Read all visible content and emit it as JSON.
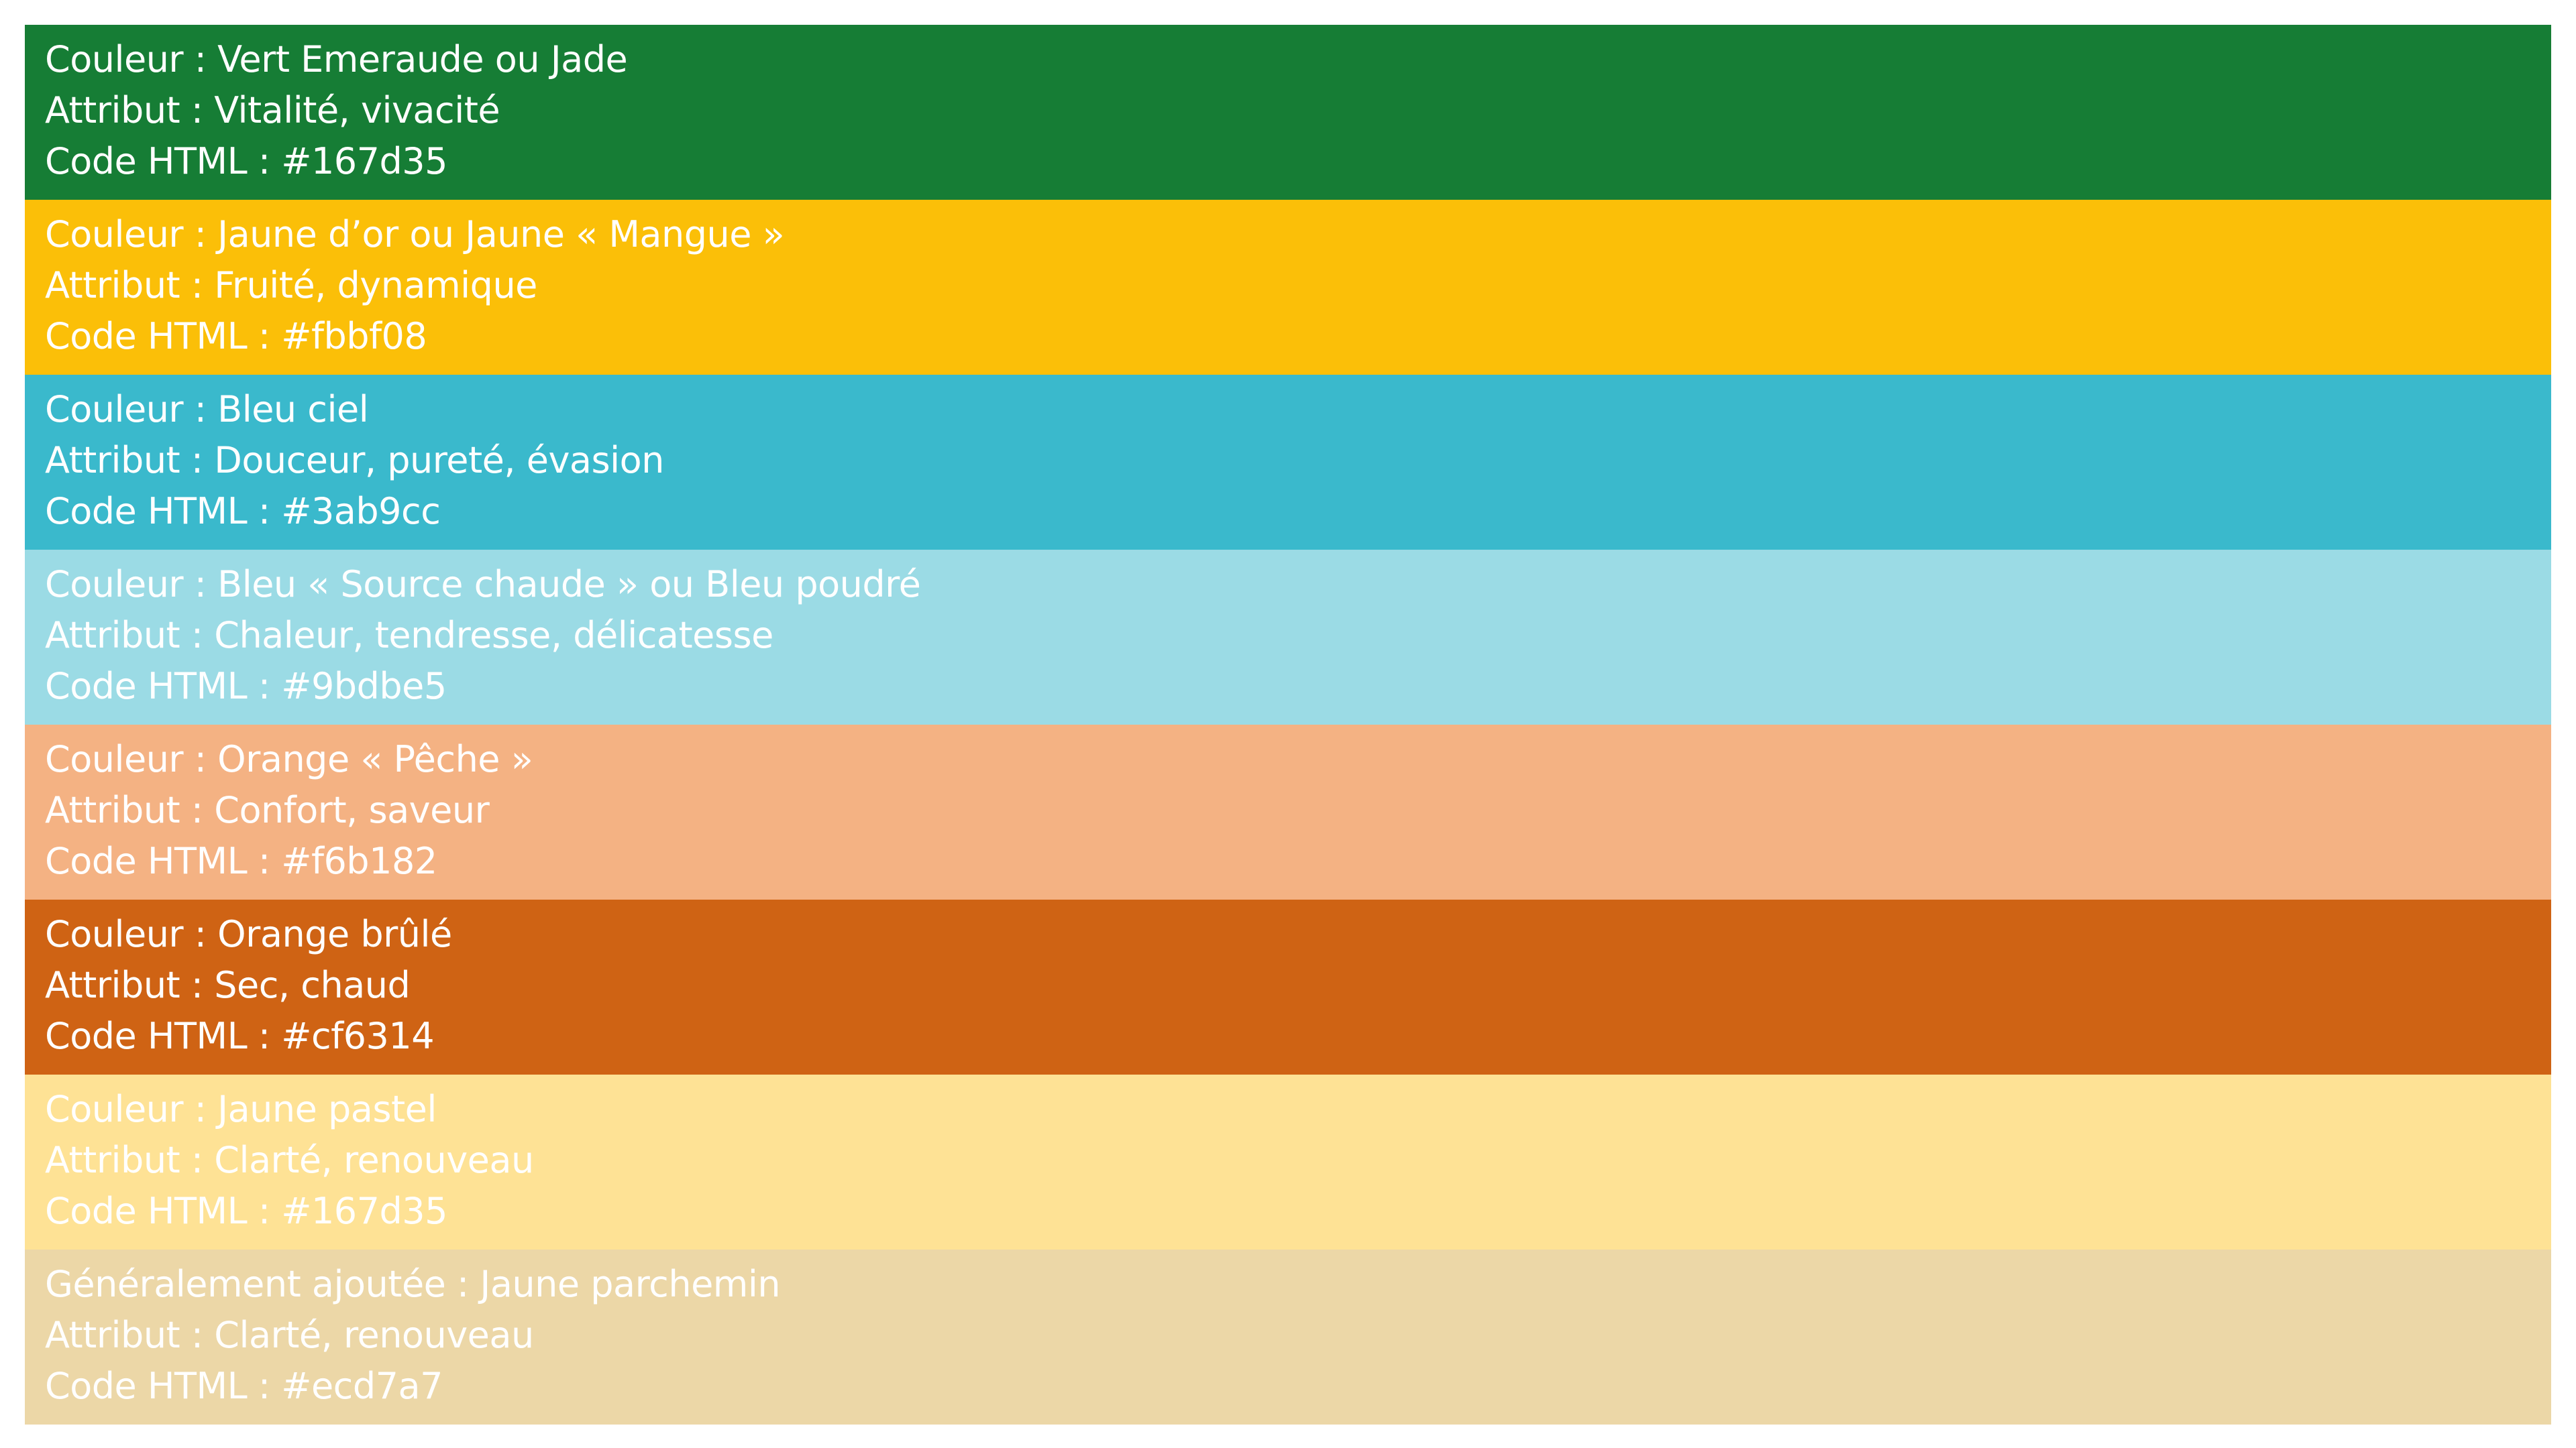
{
  "swatches": [
    {
      "color": "#167d35",
      "couleur": "Couleur : Vert Emeraude ou Jade",
      "attribut": "Attribut : Vitalité, vivacité",
      "code": "Code HTML : #167d35"
    },
    {
      "color": "#fbbf08",
      "couleur": "Couleur : Jaune d’or ou Jaune « Mangue »",
      "attribut": "Attribut : Fruité, dynamique",
      "code": "Code HTML : #fbbf08"
    },
    {
      "color": "#3ab9cc",
      "couleur": "Couleur : Bleu ciel",
      "attribut": "Attribut : Douceur, pureté, évasion",
      "code": "Code HTML : #3ab9cc"
    },
    {
      "color": "#9bdbe5",
      "couleur": "Couleur : Bleu « Source chaude » ou Bleu poudré",
      "attribut": "Attribut : Chaleur, tendresse, délicatesse",
      "code": "Code HTML : #9bdbe5"
    },
    {
      "color": "#f4b283",
      "couleur": "Couleur : Orange « Pêche »",
      "attribut": "Attribut : Confort, saveur",
      "code": "Code HTML : #f6b182"
    },
    {
      "color": "#cf6314",
      "couleur": "Couleur : Orange brûlé",
      "attribut": "Attribut : Sec, chaud",
      "code": "Code HTML : #cf6314"
    },
    {
      "color": "#fee295",
      "couleur": "Couleur : Jaune pastel",
      "attribut": "Attribut : Clarté, renouveau",
      "code": "Code HTML : #167d35"
    },
    {
      "color": "#ecd7a7",
      "couleur": "Généralement ajoutée : Jaune parchemin",
      "attribut": "Attribut : Clarté, renouveau",
      "code": "Code HTML : #ecd7a7"
    }
  ]
}
